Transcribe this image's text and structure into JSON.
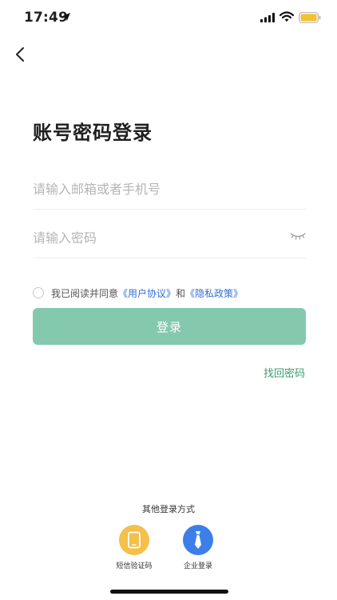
{
  "status_bar": {
    "time": "17:49"
  },
  "page": {
    "title": "账号密码登录"
  },
  "form": {
    "account_placeholder": "请输入邮箱或者手机号",
    "password_placeholder": "请输入密码"
  },
  "agreement": {
    "prefix": "我已阅读并同意",
    "user_agreement": "《用户协议》",
    "conjunction": "和",
    "privacy_policy": "《隐私政策》"
  },
  "login_button": {
    "label": "登录"
  },
  "forgot_password": {
    "label": "找回密码"
  },
  "other_login": {
    "title": "其他登录方式",
    "options": [
      {
        "label": "短信验证码",
        "icon": "phone-icon",
        "color": "#f4c04a"
      },
      {
        "label": "企业登录",
        "icon": "tie-icon",
        "color": "#3d7fe8"
      }
    ]
  },
  "colors": {
    "accent": "#84c9ad",
    "link": "#2f6fd6",
    "forgot": "#3a9c6e"
  }
}
